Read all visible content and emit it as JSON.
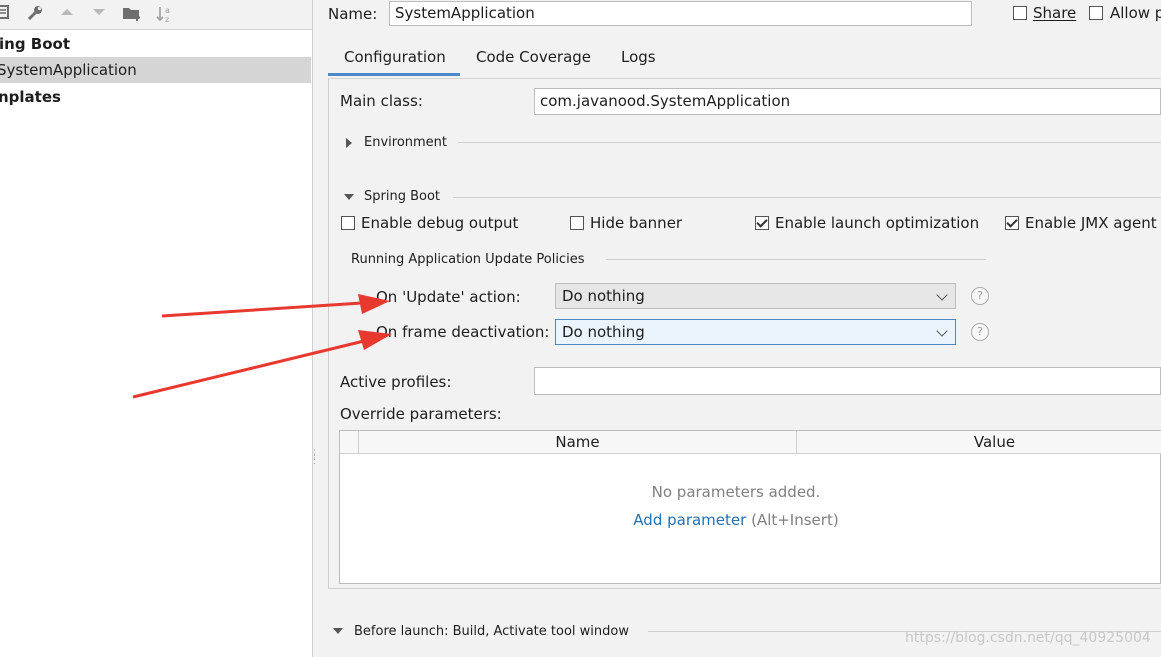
{
  "toolbar": {
    "icons": [
      "copy-icon",
      "wrench-icon",
      "arrow-up-icon",
      "arrow-down-icon",
      "folder-add-icon",
      "sort-az-icon"
    ],
    "sort_glyph": "↓a"
  },
  "tree": {
    "items": [
      {
        "label": "ing Boot",
        "bold": true
      },
      {
        "label": "SystemApplication",
        "selected": true
      },
      {
        "label": "nplates",
        "bold": true
      }
    ]
  },
  "header": {
    "name_label": "Name:",
    "name_value": "SystemApplication",
    "share_label": "Share",
    "allow_label": "Allow p"
  },
  "tabs": [
    "Configuration",
    "Code Coverage",
    "Logs"
  ],
  "config": {
    "main_class_label": "Main class:",
    "main_class_value": "com.javanood.SystemApplication",
    "environment_label": "Environment",
    "spring_boot_label": "Spring Boot",
    "checkboxes": [
      {
        "label": "Enable debug output",
        "checked": false
      },
      {
        "label": "Hide banner",
        "checked": false
      },
      {
        "label": "Enable launch optimization",
        "checked": true
      },
      {
        "label": "Enable JMX agent",
        "checked": true
      }
    ],
    "policies_label": "Running Application Update Policies",
    "update_action_label": "On 'Update' action:",
    "update_action_value": "Do nothing",
    "frame_deactivation_label": "On frame deactivation:",
    "frame_deactivation_value": "Do nothing",
    "help_glyph": "?",
    "active_profiles_label": "Active profiles:",
    "active_profiles_value": "",
    "override_label": "Override parameters:",
    "table_columns": [
      "Name",
      "Value"
    ],
    "empty_text": "No parameters added.",
    "add_parameter_label": "Add parameter",
    "add_parameter_shortcut": "(Alt+Insert)"
  },
  "before_launch_label": "Before launch: Build, Activate tool window",
  "watermark": "https://blog.csdn.net/qq_40925004",
  "colors": {
    "accent": "#4a88c7",
    "arrow": "#e8392f",
    "link": "#2470b3"
  }
}
